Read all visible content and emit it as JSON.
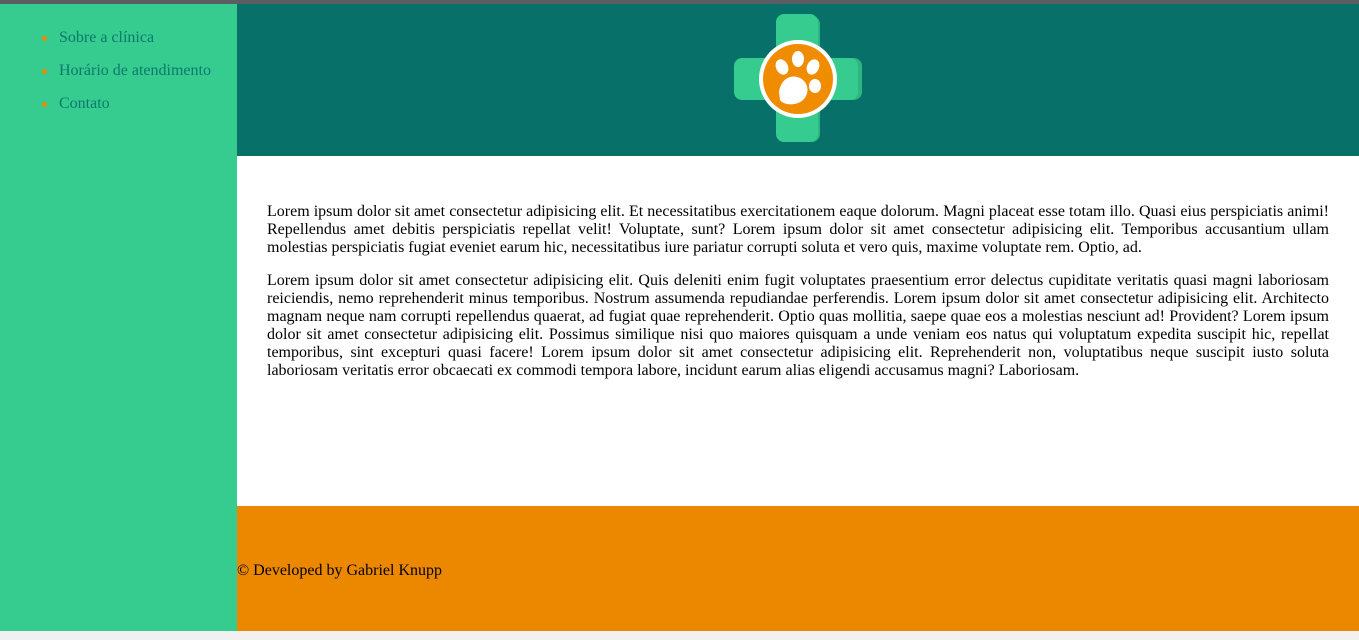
{
  "sidebar": {
    "items": [
      {
        "label": "Sobre a clínica"
      },
      {
        "label": "Horário de atendimento"
      },
      {
        "label": "Contato"
      }
    ]
  },
  "header": {
    "logo_icon": "veterinary-cross-paw-icon"
  },
  "main": {
    "paragraphs": [
      "Lorem ipsum dolor sit amet consectetur adipisicing elit. Et necessitatibus exercitationem eaque dolorum. Magni placeat esse totam illo. Quasi eius perspiciatis animi! Repellendus amet debitis perspiciatis repellat velit! Voluptate, sunt? Lorem ipsum dolor sit amet consectetur adipisicing elit. Temporibus accusantium ullam molestias perspiciatis fugiat eveniet earum hic, necessitatibus iure pariatur corrupti soluta et vero quis, maxime voluptate rem. Optio, ad.",
      "Lorem ipsum dolor sit amet consectetur adipisicing elit. Quis deleniti enim fugit voluptates praesentium error delectus cupiditate veritatis quasi magni laboriosam reiciendis, nemo reprehenderit minus temporibus. Nostrum assumenda repudiandae perferendis. Lorem ipsum dolor sit amet consectetur adipisicing elit. Architecto magnam neque nam corrupti repellendus quaerat, ad fugiat quae reprehenderit. Optio quas mollitia, saepe quae eos a molestias nesciunt ad! Provident? Lorem ipsum dolor sit amet consectetur adipisicing elit. Possimus similique nisi quo maiores quisquam a unde veniam eos natus qui voluptatum expedita suscipit hic, repellat temporibus, sint excepturi quasi facere! Lorem ipsum dolor sit amet consectetur adipisicing elit. Reprehenderit non, voluptatibus neque suscipit iusto soluta laboriosam veritatis error obcaecati ex commodi tempora labore, incidunt earum alias eligendi accusamus magni? Laboriosam."
    ]
  },
  "footer": {
    "text": "© Developed by Gabriel Knupp"
  },
  "colors": {
    "sidebar": "#36cc8f",
    "header": "#067069",
    "accent_orange": "#ec8800",
    "link": "#0b7a6d"
  }
}
